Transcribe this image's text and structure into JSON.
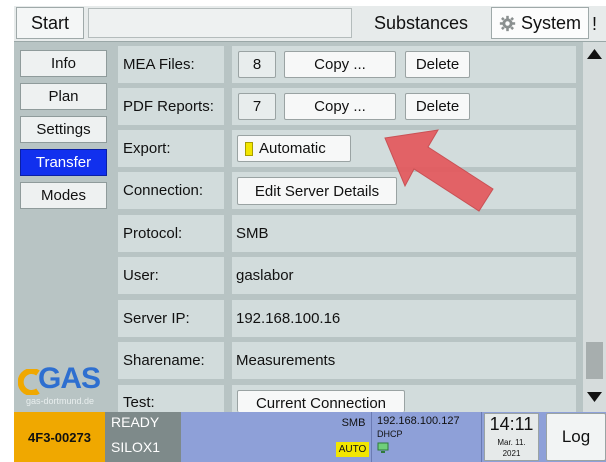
{
  "tabs": {
    "start": "Start",
    "substances": "Substances",
    "system": "System",
    "overflow": "!"
  },
  "side_menu": [
    {
      "label": "Info"
    },
    {
      "label": "Plan"
    },
    {
      "label": "Settings"
    },
    {
      "label": "Transfer"
    },
    {
      "label": "Modes"
    }
  ],
  "logo": {
    "text": "GAS",
    "subtext": "gas-dortmund.de"
  },
  "rows": {
    "mea": {
      "label": "MEA Files:",
      "count": "8",
      "copy": "Copy ...",
      "delete": "Delete"
    },
    "pdf": {
      "label": "PDF Reports:",
      "count": "7",
      "copy": "Copy ...",
      "delete": "Delete"
    },
    "export": {
      "label": "Export:",
      "value": "Automatic"
    },
    "connection": {
      "label": "Connection:",
      "button": "Edit Server Details"
    },
    "protocol": {
      "label": "Protocol:",
      "value": "SMB"
    },
    "user": {
      "label": "User:",
      "value": "gaslabor"
    },
    "server_ip": {
      "label": "Server IP:",
      "value": "192.168.100.16"
    },
    "sharename": {
      "label": "Sharename:",
      "value": "Measurements"
    },
    "test": {
      "label": "Test:",
      "button": "Current Connection"
    }
  },
  "status": {
    "device_id": "4F3-00273",
    "state": "READY",
    "instrument": "SILOX1",
    "proto": "SMB",
    "auto": "AUTO",
    "ip": "192.168.100.127",
    "dhcp": "DHCP",
    "time": "14:11",
    "date": "Mar. 11.",
    "year": "2021",
    "log": "Log"
  },
  "colors": {
    "accent_active": "#1130ee",
    "status_bar": "#8ea0d8",
    "device_id_bg": "#f0a800",
    "arrow": "#e4585c"
  }
}
